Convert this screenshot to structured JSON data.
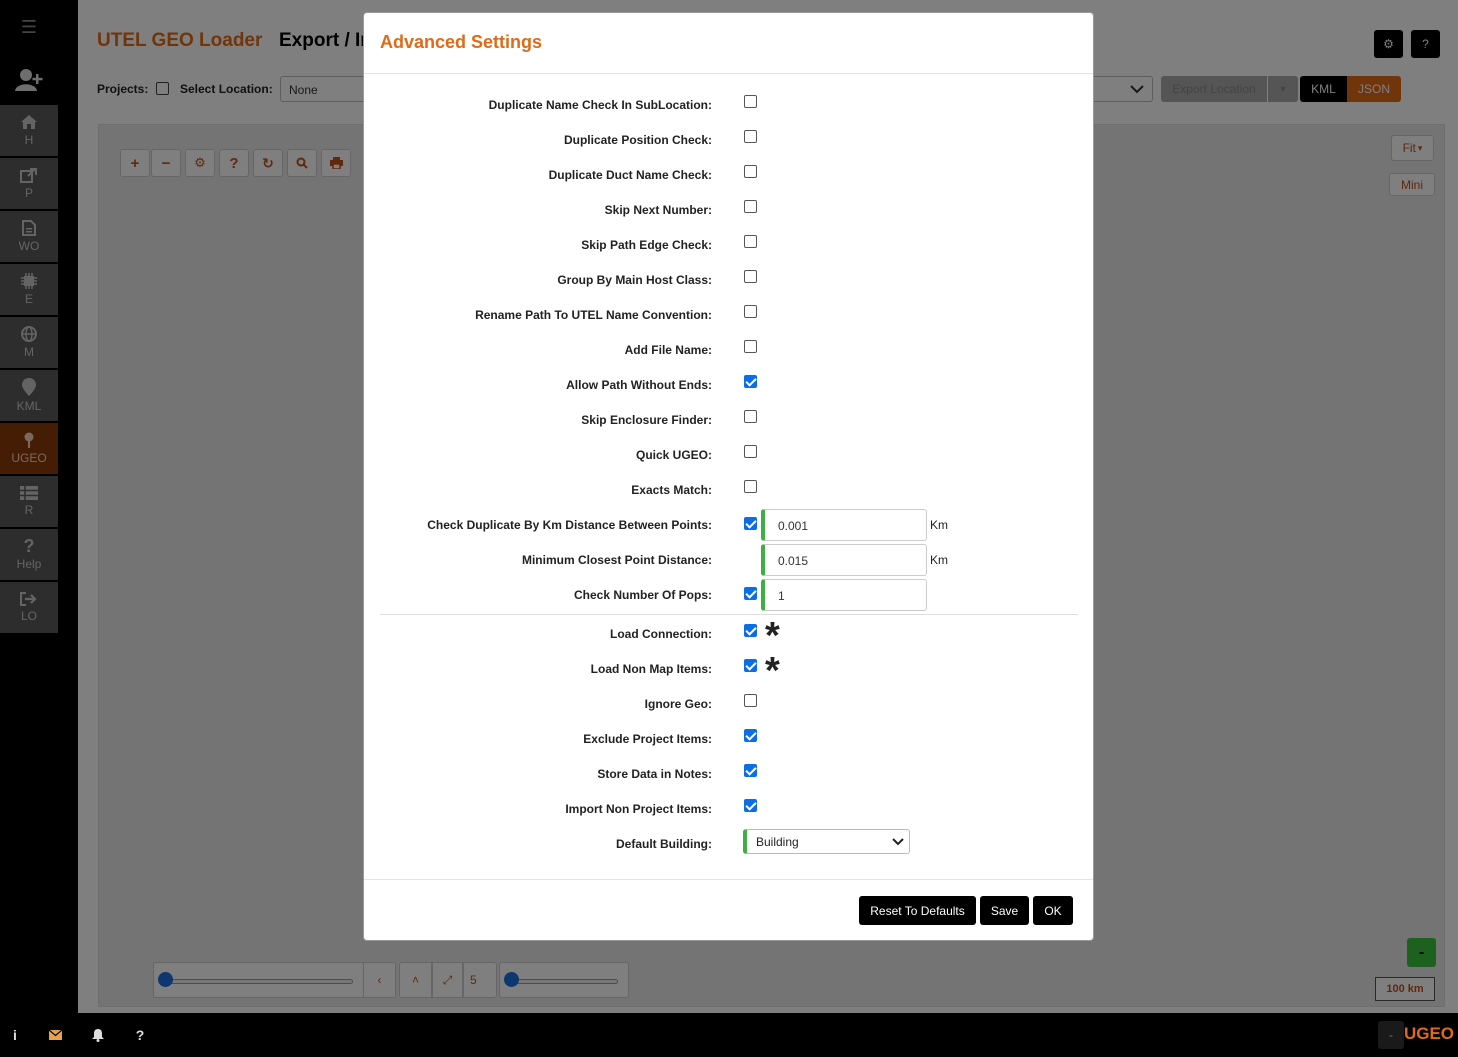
{
  "sidebar": {
    "items": [
      {
        "label": "H",
        "icon": "home-icon"
      },
      {
        "label": "P",
        "icon": "share-icon"
      },
      {
        "label": "WO",
        "icon": "file-icon"
      },
      {
        "label": "E",
        "icon": "chip-icon"
      },
      {
        "label": "M",
        "icon": "globe-icon"
      },
      {
        "label": "KML",
        "icon": "map-marker-icon"
      },
      {
        "label": "UGEO",
        "icon": "pin-icon",
        "active": true
      },
      {
        "label": "R",
        "icon": "list-icon"
      },
      {
        "label": "Help",
        "icon": "question-icon"
      },
      {
        "label": "LO",
        "icon": "logout-icon"
      }
    ]
  },
  "header": {
    "app_title": "UTEL GEO Loader",
    "page_title": "Export / Im",
    "settings_button": "⚙",
    "help_button": "?"
  },
  "toolbar": {
    "projects_label": "Projects:",
    "select_location_label": "Select Location:",
    "location_value": "None",
    "export_location": "Export Location",
    "kml": "KML",
    "json": "JSON"
  },
  "map": {
    "fit": "Fit",
    "mini": "Mini",
    "level": "5",
    "scale": "100 km",
    "green_button": "-"
  },
  "modal": {
    "title": "Advanced Settings",
    "rows": [
      {
        "label": "Duplicate Name Check In SubLocation:",
        "checked": false
      },
      {
        "label": "Duplicate Position Check:",
        "checked": false
      },
      {
        "label": "Duplicate Duct Name Check:",
        "checked": false
      },
      {
        "label": "Skip Next Number:",
        "checked": false
      },
      {
        "label": "Skip Path Edge Check:",
        "checked": false
      },
      {
        "label": "Group By Main Host Class:",
        "checked": false
      },
      {
        "label": "Rename Path To UTEL Name Convention:",
        "checked": false
      },
      {
        "label": "Add File Name:",
        "checked": false
      },
      {
        "label": "Allow Path Without Ends:",
        "checked": true
      },
      {
        "label": "Skip Enclosure Finder:",
        "checked": false
      },
      {
        "label": "Quick UGEO:",
        "checked": false
      },
      {
        "label": "Exacts Match:",
        "checked": false
      },
      {
        "label": "Check Duplicate By Km Distance Between Points:",
        "checked": true,
        "input": "0.001",
        "unit": "Km"
      },
      {
        "label": "Minimum Closest Point Distance:",
        "input": "0.015",
        "unit": "Km"
      },
      {
        "label": "Check Number Of Pops:",
        "checked": true,
        "input": "1"
      },
      {
        "label": "Load Connection:",
        "checked": true,
        "star": "*"
      },
      {
        "label": "Load Non Map Items:",
        "checked": true,
        "star": "*"
      },
      {
        "label": "Ignore Geo:",
        "checked": false
      },
      {
        "label": "Exclude Project Items:",
        "checked": true
      },
      {
        "label": "Store Data in Notes:",
        "checked": true
      },
      {
        "label": "Import Non Project Items:",
        "checked": true
      },
      {
        "label": "Default Building:",
        "select": "Building"
      }
    ],
    "buttons": {
      "reset": "Reset To Defaults",
      "save": "Save",
      "ok": "OK"
    }
  },
  "bottombar": {
    "info": "i",
    "help": "?",
    "minimize": "-",
    "brand": "UGEO"
  },
  "colors": {
    "accent": "#e06a17",
    "active_sidebar": "#c0521a",
    "checkbox": "#0b6ee6",
    "input_border": "#3cb043"
  }
}
